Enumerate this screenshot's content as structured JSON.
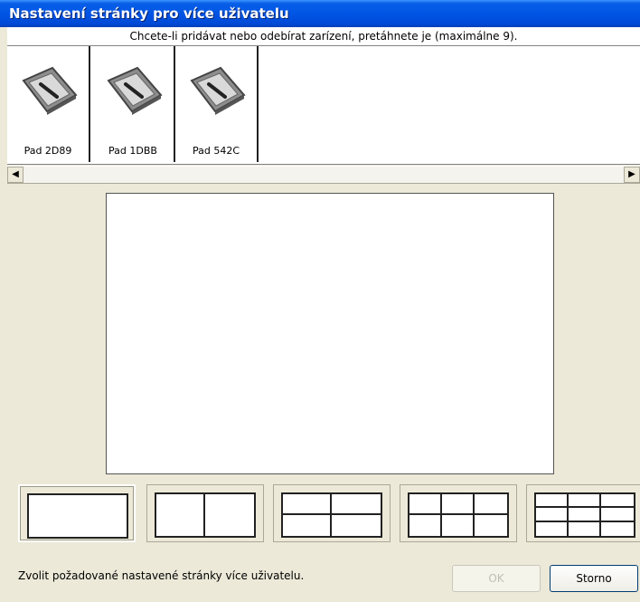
{
  "window": {
    "title": "Nastavení stránky pro více uživatelu"
  },
  "subheader": "Chcete-li pridávat nebo odebírat zarízení, pretáhnete je (maximálne 9).",
  "devices": [
    {
      "label": "Pad 2D89",
      "icon": "tablet-icon"
    },
    {
      "label": "Pad 1DBB",
      "icon": "tablet-icon"
    },
    {
      "label": "Pad 542C",
      "icon": "tablet-icon"
    }
  ],
  "scrollbar": {
    "left_arrow": "◀",
    "right_arrow": "▶"
  },
  "layouts": [
    {
      "name": "1",
      "cols": 1,
      "rows": 1,
      "selected": true
    },
    {
      "name": "2",
      "cols": 2,
      "rows": 1,
      "selected": false
    },
    {
      "name": "4",
      "cols": 2,
      "rows": 2,
      "selected": false
    },
    {
      "name": "6",
      "cols": 3,
      "rows": 2,
      "selected": false
    },
    {
      "name": "9",
      "cols": 3,
      "rows": 3,
      "selected": false
    }
  ],
  "status_text": "Zvolit požadované nastavené stránky více uživatelu.",
  "buttons": {
    "ok": "OK",
    "cancel": "Storno"
  }
}
